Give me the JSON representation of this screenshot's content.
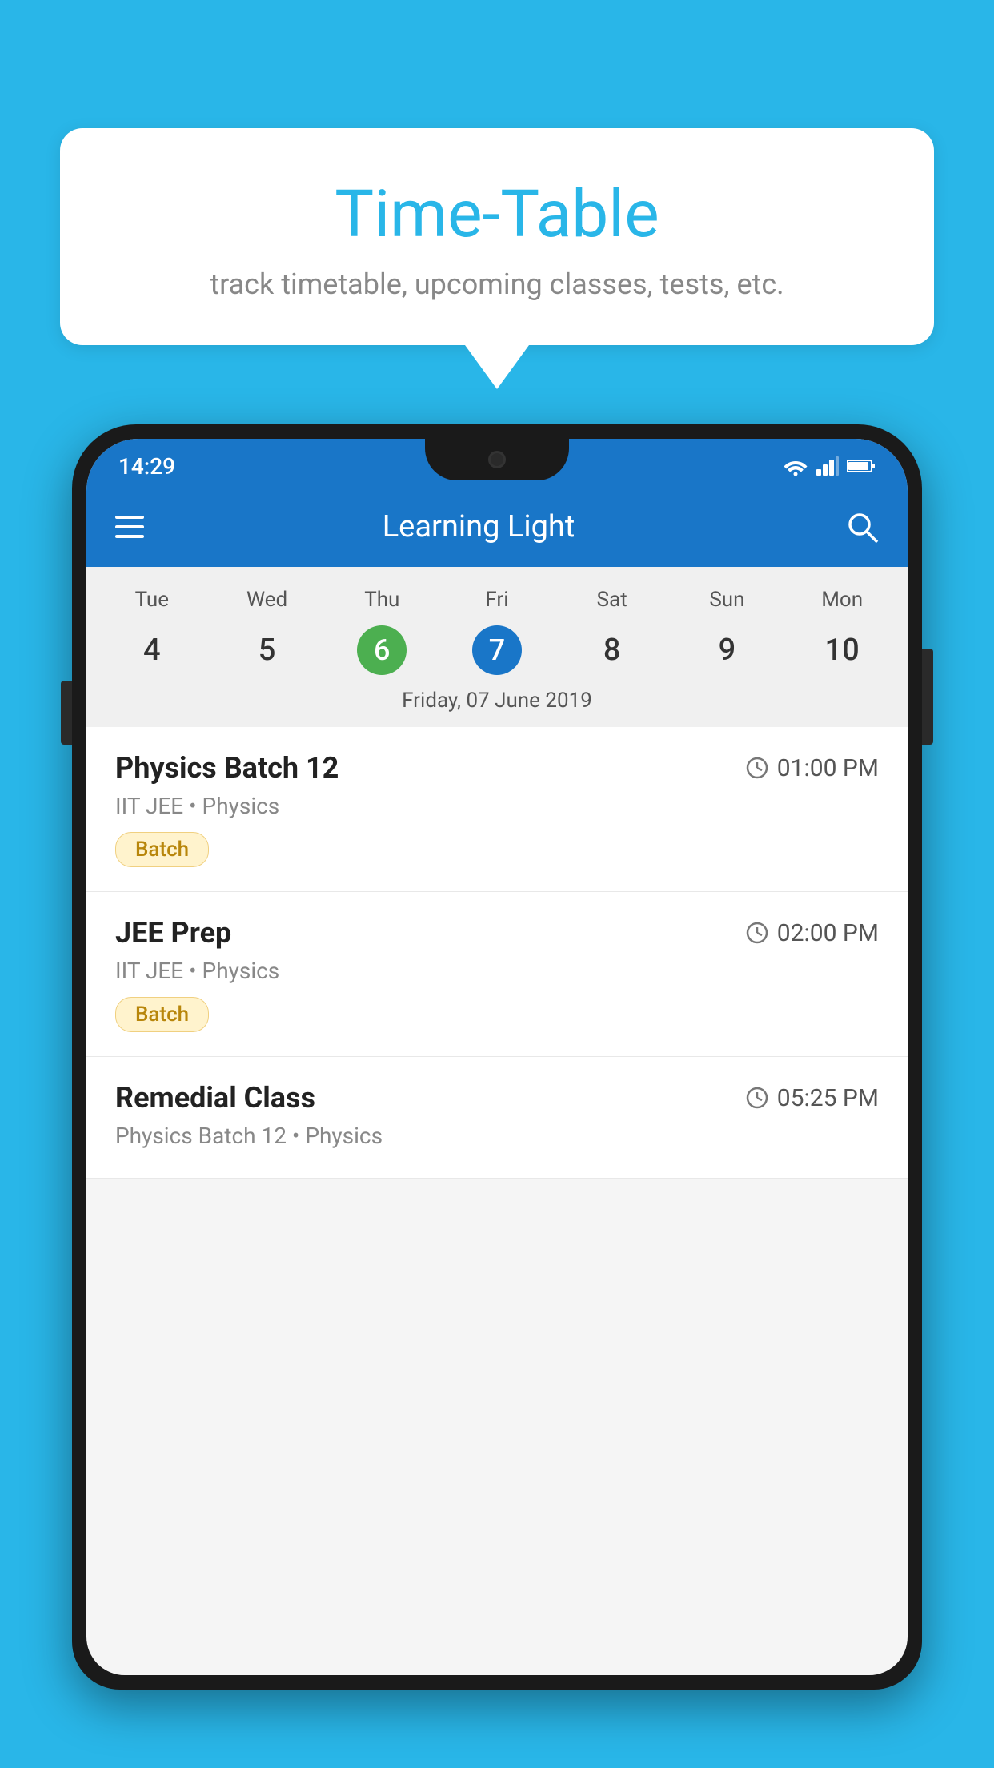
{
  "background_color": "#29B6E8",
  "speech_bubble": {
    "title": "Time-Table",
    "subtitle": "track timetable, upcoming classes, tests, etc."
  },
  "phone": {
    "status_bar": {
      "time": "14:29"
    },
    "app_bar": {
      "title": "Learning Light"
    },
    "calendar": {
      "days": [
        "Tue",
        "Wed",
        "Thu",
        "Fri",
        "Sat",
        "Sun",
        "Mon"
      ],
      "dates": [
        "4",
        "5",
        "6",
        "7",
        "8",
        "9",
        "10"
      ],
      "today_index": 2,
      "selected_index": 3,
      "selected_date_label": "Friday, 07 June 2019"
    },
    "schedule_items": [
      {
        "title": "Physics Batch 12",
        "time": "01:00 PM",
        "meta": "IIT JEE • Physics",
        "badge": "Batch"
      },
      {
        "title": "JEE Prep",
        "time": "02:00 PM",
        "meta": "IIT JEE • Physics",
        "badge": "Batch"
      },
      {
        "title": "Remedial Class",
        "time": "05:25 PM",
        "meta": "Physics Batch 12 • Physics",
        "badge": null
      }
    ]
  }
}
